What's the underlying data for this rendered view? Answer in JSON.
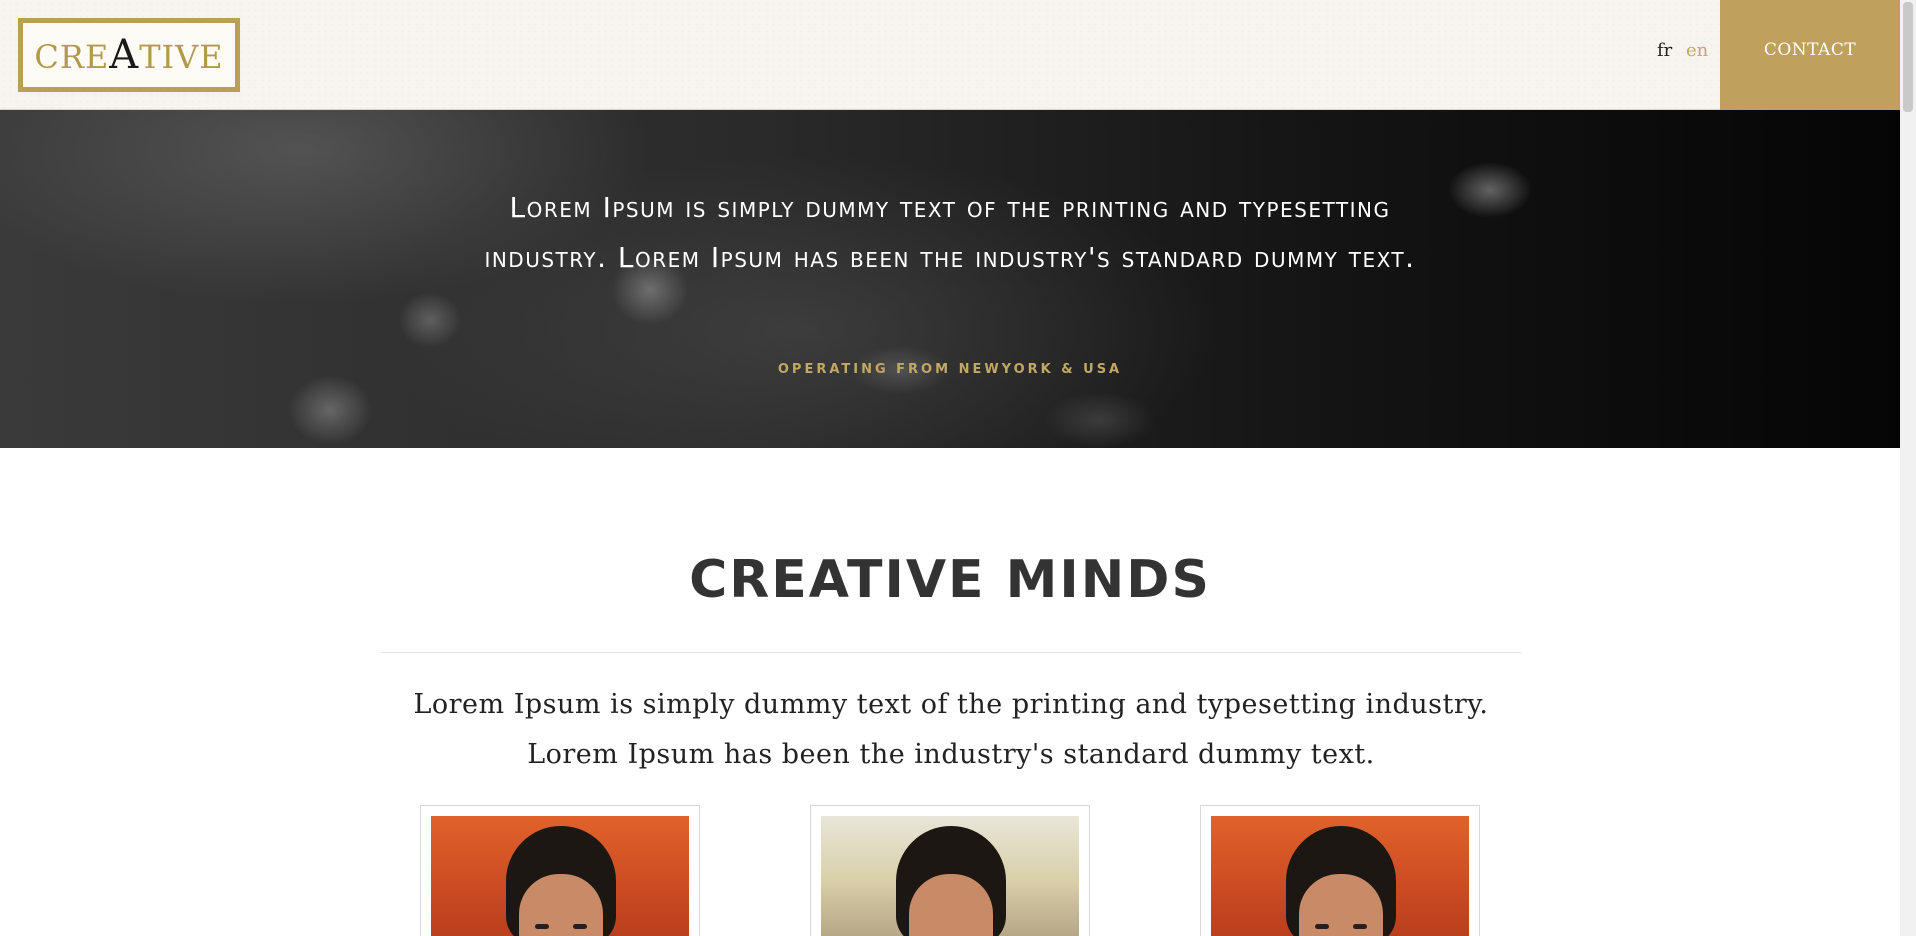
{
  "header": {
    "logo": {
      "prefix": "CRE",
      "emphasis": "A",
      "suffix": "TIVE"
    },
    "languages": [
      "fr",
      "en"
    ],
    "active_language": "en",
    "contact_label": "CONTACT"
  },
  "hero": {
    "quote": "Lorem Ipsum is simply dummy text of the printing and typesetting industry. Lorem Ipsum has been the industry's standard dummy text.",
    "subtitle": "OPERATING FROM NEWYORK & USA"
  },
  "section": {
    "title": "CREATIVE MINDS",
    "description": "Lorem Ipsum is simply dummy text of the printing and typesetting industry. Lorem Ipsum has been the industry's standard dummy text."
  },
  "team": {
    "members": [
      {
        "photo": "portrait-warm-background"
      },
      {
        "photo": "portrait-light-background"
      },
      {
        "photo": "portrait-warm-background"
      }
    ]
  },
  "colors": {
    "accent": "#bfa15d",
    "header_bg": "#f7f4ef",
    "title_text": "#333333"
  }
}
